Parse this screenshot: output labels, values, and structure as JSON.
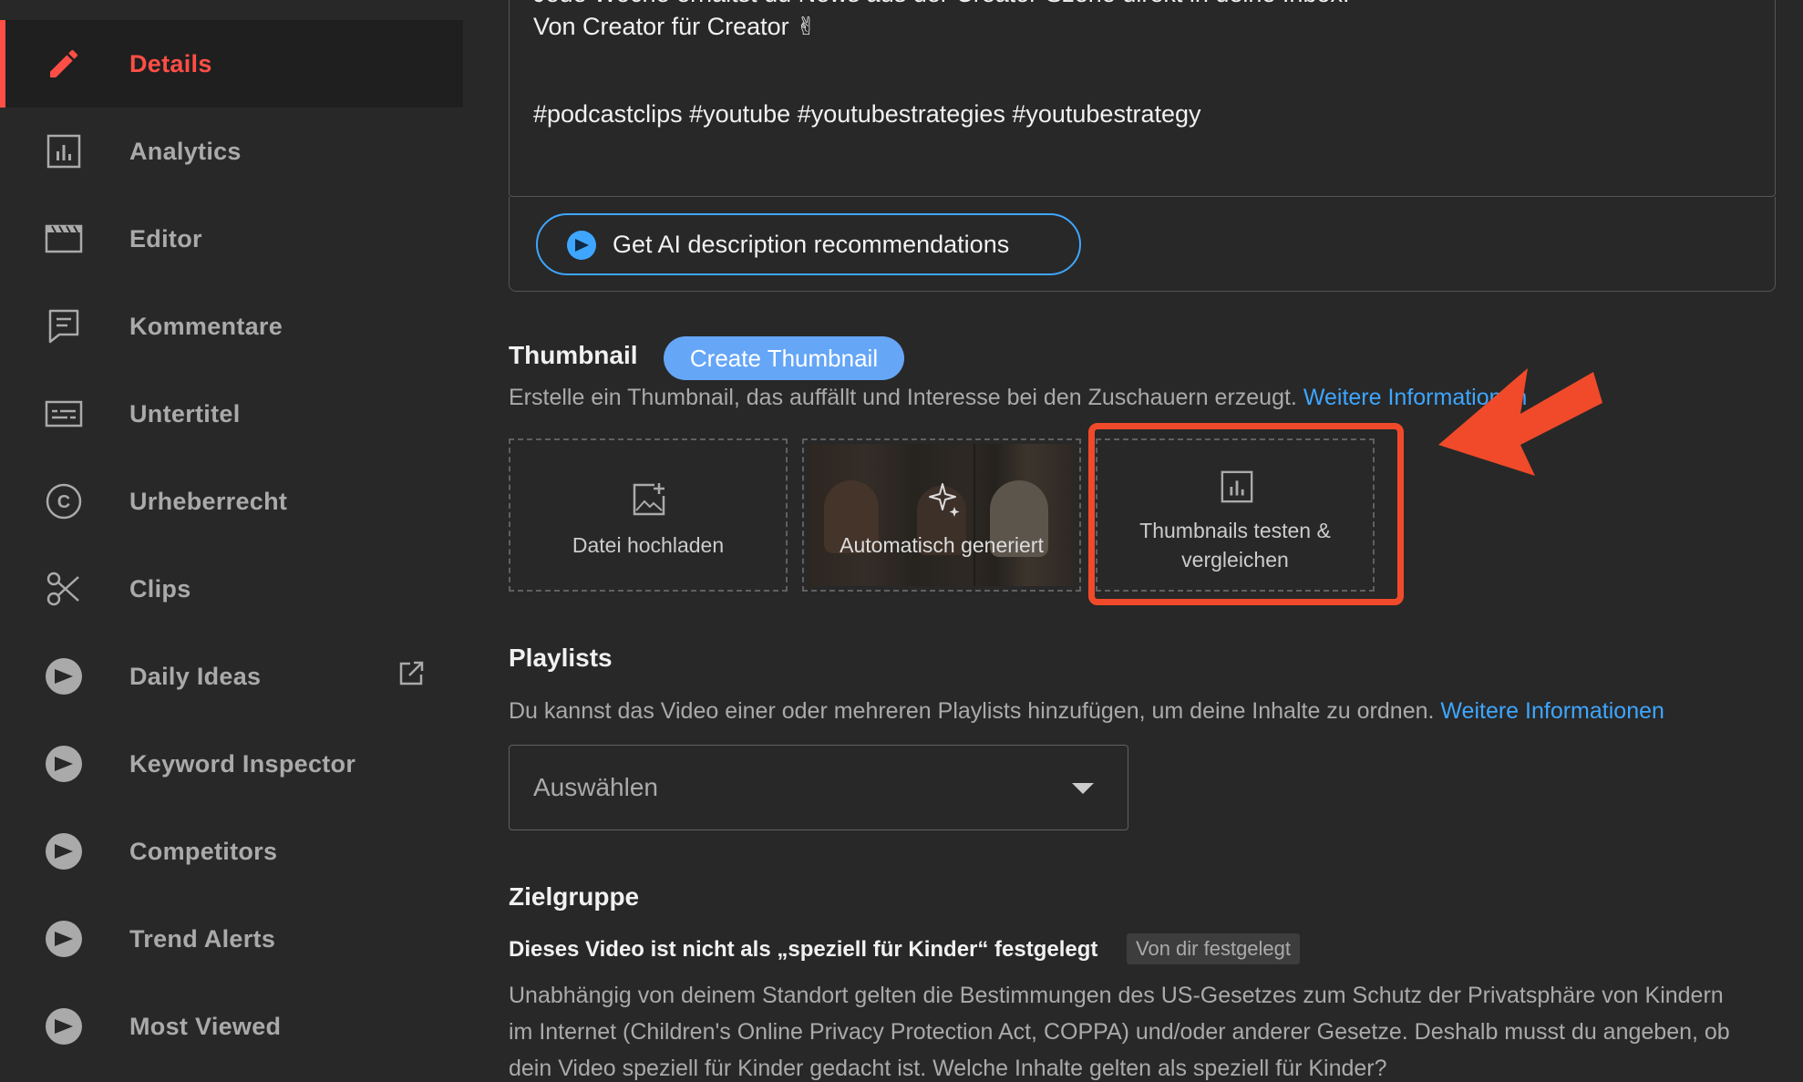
{
  "sidebar": {
    "items": [
      {
        "label": "Details",
        "icon": "pencil-icon",
        "active": true
      },
      {
        "label": "Analytics",
        "icon": "analytics-icon"
      },
      {
        "label": "Editor",
        "icon": "film-icon"
      },
      {
        "label": "Kommentare",
        "icon": "comment-icon"
      },
      {
        "label": "Untertitel",
        "icon": "subtitles-icon"
      },
      {
        "label": "Urheberrecht",
        "icon": "copyright-icon"
      },
      {
        "label": "Clips",
        "icon": "scissors-icon"
      },
      {
        "label": "Daily Ideas",
        "icon": "vidiq-icon",
        "external": true
      },
      {
        "label": "Keyword Inspector",
        "icon": "vidiq-icon"
      },
      {
        "label": "Competitors",
        "icon": "vidiq-icon"
      },
      {
        "label": "Trend Alerts",
        "icon": "vidiq-icon"
      },
      {
        "label": "Most Viewed",
        "icon": "vidiq-icon"
      }
    ]
  },
  "description": {
    "partial_line": "Jede Woche erhältst du News aus der Creator-Szene direkt in deine Inbox.",
    "line2": "Von Creator für Creator ✌",
    "hashtags": "#podcastclips #youtube #youtubestrategies #youtubestrategy",
    "ai_button": "Get AI description recommendations"
  },
  "thumbnail": {
    "title": "Thumbnail",
    "create_button": "Create Thumbnail",
    "subtitle": "Erstelle ein Thumbnail, das auffällt und Interesse bei den Zuschauern erzeugt.",
    "link": "Weitere Informationen",
    "upload_label": "Datei hochladen",
    "auto_label": "Automatisch generiert",
    "test_label_1": "Thumbnails testen &",
    "test_label_2": "vergleichen"
  },
  "playlists": {
    "title": "Playlists",
    "subtitle": "Du kannst das Video einer oder mehreren Playlists hinzufügen, um deine Inhalte zu ordnen.",
    "link": "Weitere Informationen",
    "select_value": "Auswählen"
  },
  "audience": {
    "title": "Zielgruppe",
    "status": "Dieses Video ist nicht als „speziell für Kinder“ festgelegt",
    "badge": "Von dir festgelegt",
    "body1": "Unabhängig von deinem Standort gelten die Bestimmungen des US-Gesetzes zum Schutz der Privatsphäre von Kindern",
    "body2": "im Internet (Children's Online Privacy Protection Act, COPPA) und/oder anderer Gesetze. Deshalb musst du angeben, ob",
    "body3": "dein Video speziell für Kinder gedacht ist. Welche Inhalte gelten als speziell für Kinder?"
  },
  "colors": {
    "accent_red": "#ff4e45",
    "link_blue": "#3ea6ff",
    "highlight_orange": "#f04a2a",
    "create_btn": "#65a6f7"
  }
}
